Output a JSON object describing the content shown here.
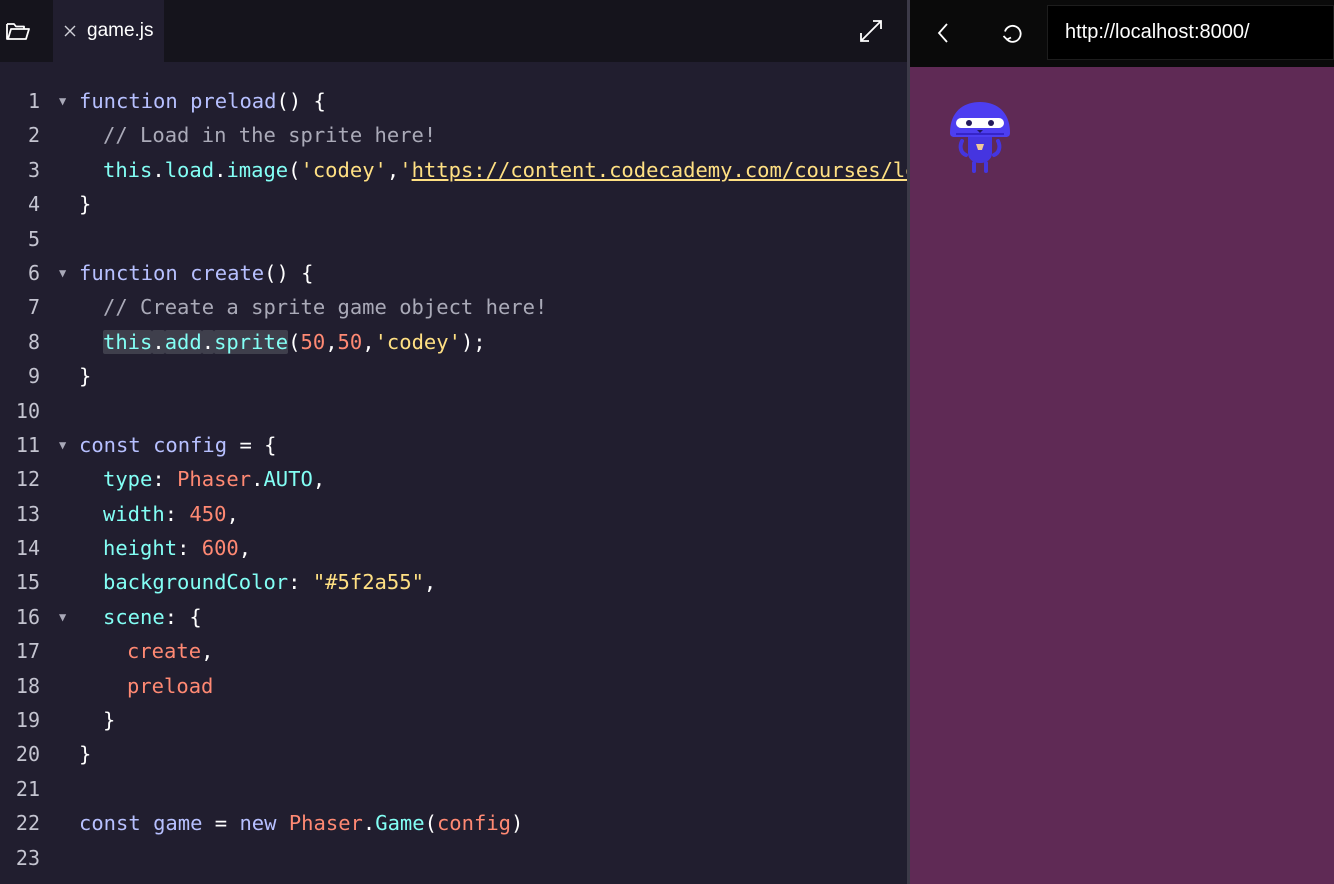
{
  "editor": {
    "tab": {
      "label": "game.js"
    },
    "icons": {
      "folder": "folder-icon",
      "close": "close-icon",
      "expand": "expand-icon"
    },
    "lines": [
      {
        "n": "1",
        "fold": true,
        "indent": 0,
        "tokens": [
          [
            "kw",
            "function "
          ],
          [
            "fn",
            "preload"
          ],
          [
            "",
            "() {"
          ]
        ]
      },
      {
        "n": "2",
        "fold": false,
        "indent": 1,
        "tokens": [
          [
            "cm",
            "// Load in the sprite here!"
          ]
        ]
      },
      {
        "n": "3",
        "fold": false,
        "indent": 1,
        "tokens": [
          [
            "pr",
            "this"
          ],
          [
            "",
            "."
          ],
          [
            "pr",
            "load"
          ],
          [
            "",
            "."
          ],
          [
            "pr",
            "image"
          ],
          [
            "",
            "("
          ],
          [
            "st",
            "'codey'"
          ],
          [
            "",
            ","
          ],
          [
            "st",
            "'"
          ],
          [
            "st ul",
            "https://content.codecademy.com/courses/lea"
          ]
        ]
      },
      {
        "n": "4",
        "fold": false,
        "indent": 0,
        "tokens": [
          [
            "",
            "}"
          ]
        ]
      },
      {
        "n": "5",
        "fold": false,
        "indent": 0,
        "tokens": []
      },
      {
        "n": "6",
        "fold": true,
        "indent": 0,
        "tokens": [
          [
            "kw",
            "function "
          ],
          [
            "fn",
            "create"
          ],
          [
            "",
            "() {"
          ]
        ]
      },
      {
        "n": "7",
        "fold": false,
        "indent": 1,
        "tokens": [
          [
            "cm",
            "// Create a sprite game object here!"
          ]
        ]
      },
      {
        "n": "8",
        "fold": false,
        "indent": 1,
        "tokens": [
          [
            "pr hl",
            "this"
          ],
          [
            "hl",
            "."
          ],
          [
            "pr hl",
            "add"
          ],
          [
            "hl",
            "."
          ],
          [
            "pr hl",
            "sprite"
          ],
          [
            "",
            "("
          ],
          [
            "nm",
            "50"
          ],
          [
            "",
            ","
          ],
          [
            "nm",
            "50"
          ],
          [
            "",
            ","
          ],
          [
            "st",
            "'codey'"
          ],
          [
            "",
            ");"
          ]
        ]
      },
      {
        "n": "9",
        "fold": false,
        "indent": 0,
        "tokens": [
          [
            "",
            "}"
          ]
        ]
      },
      {
        "n": "10",
        "fold": false,
        "indent": 0,
        "tokens": []
      },
      {
        "n": "11",
        "fold": true,
        "indent": 0,
        "tokens": [
          [
            "kw",
            "const "
          ],
          [
            "fn",
            "config"
          ],
          [
            "",
            " = {"
          ]
        ]
      },
      {
        "n": "12",
        "fold": false,
        "indent": 1,
        "tokens": [
          [
            "pr",
            "type"
          ],
          [
            "",
            ": "
          ],
          [
            "ph",
            "Phaser"
          ],
          [
            "",
            "."
          ],
          [
            "pr",
            "AUTO"
          ],
          [
            "",
            ","
          ]
        ]
      },
      {
        "n": "13",
        "fold": false,
        "indent": 1,
        "tokens": [
          [
            "pr",
            "width"
          ],
          [
            "",
            ": "
          ],
          [
            "nm",
            "450"
          ],
          [
            "",
            ","
          ]
        ]
      },
      {
        "n": "14",
        "fold": false,
        "indent": 1,
        "tokens": [
          [
            "pr",
            "height"
          ],
          [
            "",
            ": "
          ],
          [
            "nm",
            "600"
          ],
          [
            "",
            ","
          ]
        ]
      },
      {
        "n": "15",
        "fold": false,
        "indent": 1,
        "tokens": [
          [
            "pr",
            "backgroundColor"
          ],
          [
            "",
            ": "
          ],
          [
            "st",
            "\"#5f2a55\""
          ],
          [
            "",
            ","
          ]
        ]
      },
      {
        "n": "16",
        "fold": true,
        "indent": 1,
        "tokens": [
          [
            "pr",
            "scene"
          ],
          [
            "",
            ": {"
          ]
        ]
      },
      {
        "n": "17",
        "fold": false,
        "indent": 2,
        "tokens": [
          [
            "nm",
            "create"
          ],
          [
            "",
            ","
          ]
        ]
      },
      {
        "n": "18",
        "fold": false,
        "indent": 2,
        "tokens": [
          [
            "nm",
            "preload"
          ]
        ]
      },
      {
        "n": "19",
        "fold": false,
        "indent": 1,
        "tokens": [
          [
            "",
            "}"
          ]
        ]
      },
      {
        "n": "20",
        "fold": false,
        "indent": 0,
        "tokens": [
          [
            "",
            "}"
          ]
        ]
      },
      {
        "n": "21",
        "fold": false,
        "indent": 0,
        "tokens": []
      },
      {
        "n": "22",
        "fold": false,
        "indent": 0,
        "tokens": [
          [
            "kw",
            "const "
          ],
          [
            "fn",
            "game"
          ],
          [
            "",
            " = "
          ],
          [
            "kw",
            "new "
          ],
          [
            "ph",
            "Phaser"
          ],
          [
            "",
            "."
          ],
          [
            "pr",
            "Game"
          ],
          [
            "",
            "("
          ],
          [
            "nm",
            "config"
          ],
          [
            "",
            ")"
          ]
        ]
      },
      {
        "n": "23",
        "fold": false,
        "indent": 0,
        "tokens": []
      }
    ]
  },
  "browser": {
    "url": "http://localhost:8000/",
    "icons": {
      "back": "back-icon",
      "refresh": "refresh-icon"
    }
  },
  "game": {
    "background_color": "#5f2a55",
    "sprite": "codey-sprite"
  },
  "colors": {
    "keyword": "#b7c0ff",
    "property": "#83fff5",
    "string": "#ffe083",
    "number": "#ff8973",
    "comment": "#aaaab8"
  }
}
